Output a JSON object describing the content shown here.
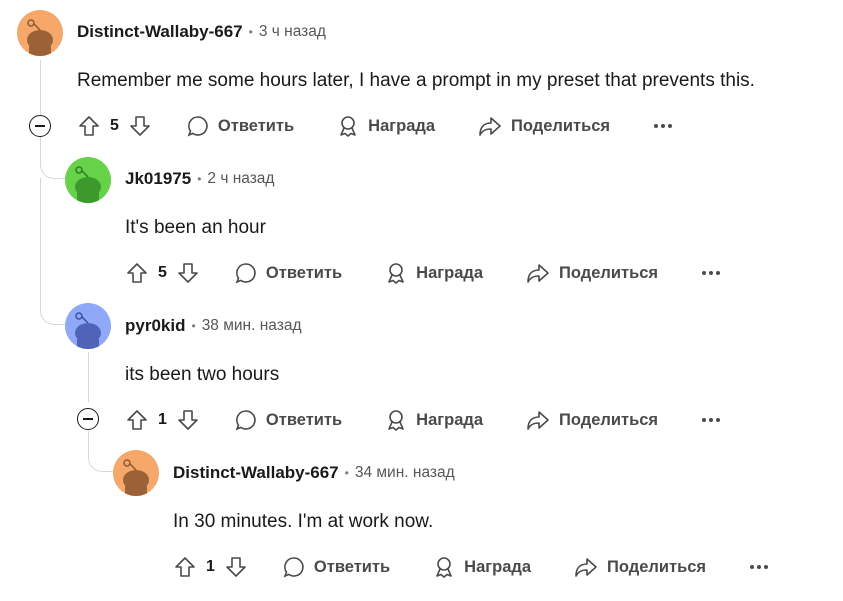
{
  "comments": [
    {
      "author": "Distinct-Wallaby-667",
      "time": "3 ч назад",
      "text": "Remember me some hours later, I have a prompt in my preset that prevents this.",
      "score": "5",
      "avatar_color": "#f6a86a"
    },
    {
      "author": "Jk01975",
      "time": "2 ч назад",
      "text": "It's been an hour",
      "score": "5",
      "avatar_color": "#66d24a"
    },
    {
      "author": "pyr0kid",
      "time": "38 мин. назад",
      "text": "its been two hours",
      "score": "1",
      "avatar_color": "#8fa8f7"
    },
    {
      "author": "Distinct-Wallaby-667",
      "time": "34 мин. назад",
      "text": "In 30 minutes. I'm at work now.",
      "score": "1",
      "avatar_color": "#f6a86a"
    }
  ],
  "actions": {
    "reply": "Ответить",
    "award": "Награда",
    "share": "Поделиться"
  }
}
